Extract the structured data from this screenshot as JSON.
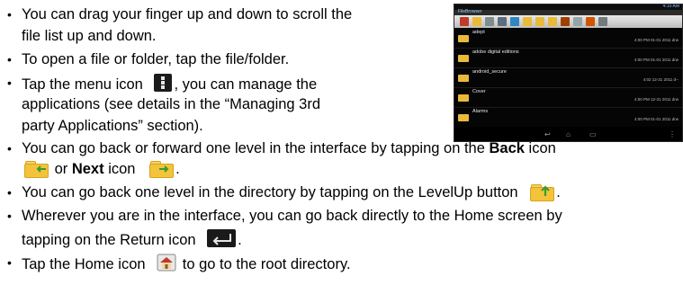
{
  "bullets": [
    {
      "text": "You can drag your finger up and down to scroll the"
    },
    {
      "text": "file list up and down."
    },
    {
      "text": "To open a file or folder, tap the file/folder."
    },
    {
      "pre": "Tap the menu icon",
      "post": ", you can manage the"
    },
    {
      "text": "applications (see details in the “Managing 3rd"
    },
    {
      "text": "party Applications” section)."
    },
    {
      "pre": "You can go back or forward one level in the interface by tapping on the ",
      "bold1": "Back",
      "mid": " icon"
    },
    {
      "pre": " or ",
      "bold1": "Next",
      "mid": " icon",
      "post": "."
    },
    {
      "pre": "You can go back one level in the directory by tapping on the LevelUp button",
      "post": "."
    },
    {
      "text": "Wherever you are in the interface, you can go back directly to the Home screen by"
    },
    {
      "pre": "tapping on the Return icon",
      "post": "."
    },
    {
      "pre": "Tap the Home icon",
      "post": " to go to the root directory."
    }
  ],
  "device": {
    "status_text": "4:10 AM",
    "title": "FileBrowser",
    "rows": [
      {
        "name": "adept",
        "meta": "4:00 PM 01-01 2011 drw"
      },
      {
        "name": "adobe digital editions",
        "meta": "4:00 PM 01-01 2011 drw"
      },
      {
        "name": "android_secure",
        "meta": "4:02 12-31 2011 d--"
      },
      {
        "name": "Cover",
        "meta": "4:00 PM 12-31 2011 drw"
      },
      {
        "name": "Alarms",
        "meta": "4:00 PM 01-01 2011 drw"
      }
    ]
  },
  "colors": {
    "folder": "#f3c43b",
    "arrow_green": "#3c9a2f",
    "device_bg": "#050505"
  }
}
